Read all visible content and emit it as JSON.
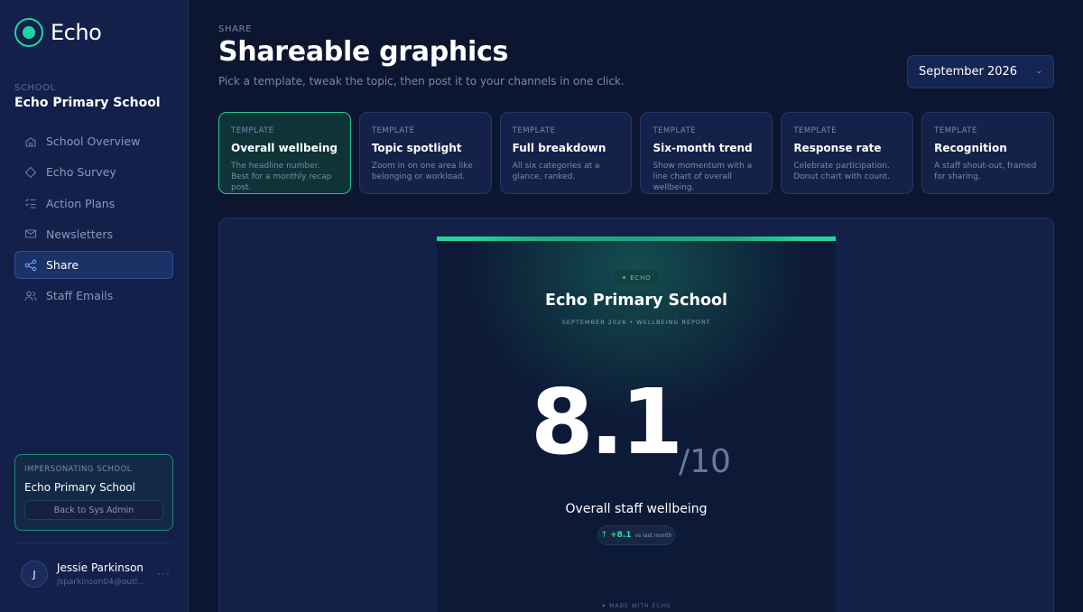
{
  "brand": {
    "name": "Echo"
  },
  "sidebar": {
    "school_label": "SCHOOL",
    "school_name": "Echo Primary School",
    "items": [
      {
        "label": "School Overview",
        "icon": "school-icon"
      },
      {
        "label": "Echo Survey",
        "icon": "diamond-icon"
      },
      {
        "label": "Action Plans",
        "icon": "checklist-icon"
      },
      {
        "label": "Newsletters",
        "icon": "mail-icon"
      },
      {
        "label": "Share",
        "icon": "share-icon",
        "active": true
      },
      {
        "label": "Staff Emails",
        "icon": "users-icon"
      }
    ],
    "impersonation": {
      "label": "IMPERSONATING SCHOOL",
      "school": "Echo Primary School",
      "back_label": "Back to Sys Admin"
    },
    "user": {
      "initial": "J",
      "name": "Jessie Parkinson",
      "email": "jsparkinson04@outlo...",
      "more": "···"
    }
  },
  "header": {
    "eyebrow": "SHARE",
    "title": "Shareable graphics",
    "subtitle": "Pick a template, tweak the topic, then post it to your channels in one click.",
    "month": "September 2026"
  },
  "templates": [
    {
      "label": "TEMPLATE",
      "title": "Overall wellbeing",
      "desc": "The headline number. Best for a monthly recap post.",
      "active": true
    },
    {
      "label": "TEMPLATE",
      "title": "Topic spotlight",
      "desc": "Zoom in on one area like belonging or workload."
    },
    {
      "label": "TEMPLATE",
      "title": "Full breakdown",
      "desc": "All six categories at a glance, ranked."
    },
    {
      "label": "TEMPLATE",
      "title": "Six-month trend",
      "desc": "Show momentum with a line chart of overall wellbeing."
    },
    {
      "label": "TEMPLATE",
      "title": "Response rate",
      "desc": "Celebrate participation. Donut chart with count."
    },
    {
      "label": "TEMPLATE",
      "title": "Recognition",
      "desc": "A staff shout-out, framed for sharing."
    }
  ],
  "preview": {
    "pill": "✦ ECHO",
    "school": "Echo Primary School",
    "meta": "SEPTEMBER 2026  •  WELLBEING REPORT",
    "score": "8.1",
    "denominator": "/10",
    "caption": "Overall staff wellbeing",
    "delta_arrow": "↑",
    "delta_value": "+8.1",
    "delta_context": "vs last month",
    "footer": "✦ MADE WITH ECHO"
  },
  "colors": {
    "accent": "#23d59a",
    "background": "#0c1630",
    "sidebar": "#13204a"
  }
}
